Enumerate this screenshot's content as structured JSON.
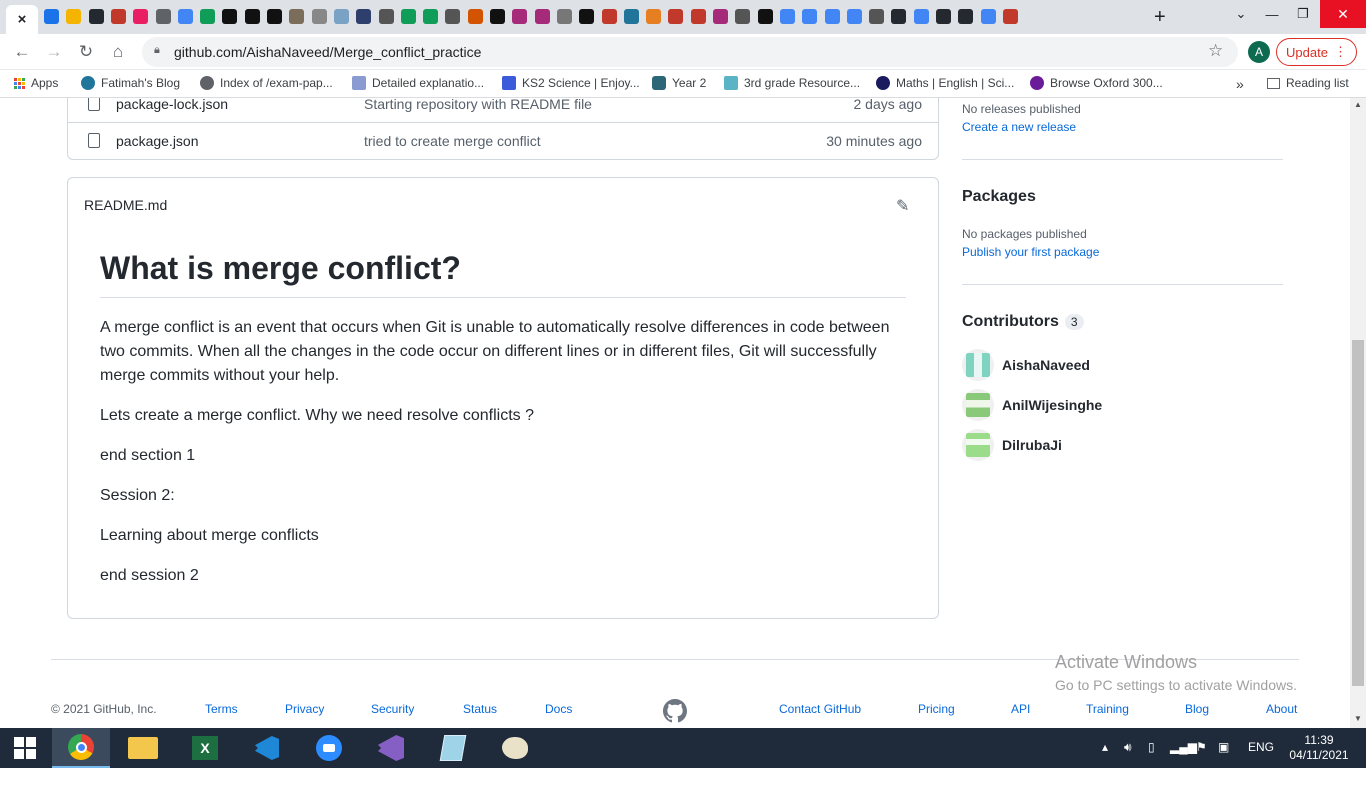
{
  "browser": {
    "url": "github.com/AishaNaveed/Merge_conflict_practice",
    "update_label": "Update",
    "avatar_letter": "A",
    "new_tab_symbol": "+",
    "active_tab_close": "×"
  },
  "bookmarks": [
    {
      "label": "Apps"
    },
    {
      "label": "Fatimah's Blog"
    },
    {
      "label": "Index of /exam-pap..."
    },
    {
      "label": "Detailed explanatio..."
    },
    {
      "label": "KS2 Science | Enjoy..."
    },
    {
      "label": "Year 2"
    },
    {
      "label": "3rd grade Resource..."
    },
    {
      "label": "Maths | English | Sci..."
    },
    {
      "label": "Browse Oxford 300..."
    }
  ],
  "bookmarks_more": "»",
  "reading_list": "Reading list",
  "files": [
    {
      "name": "package-lock.json",
      "message": "Starting repository with README file",
      "age": "2 days ago"
    },
    {
      "name": "package.json",
      "message": "tried to create merge conflict",
      "age": "30 minutes ago"
    }
  ],
  "readme": {
    "filename": "README.md",
    "heading": "What is merge conflict?",
    "paragraphs": [
      "A merge conflict is an event that occurs when Git is unable to automatically resolve differences in code between two commits. When all the changes in the code occur on different lines or in different files, Git will successfully merge commits without your help.",
      "Lets create a merge conflict. Why we need resolve conflicts ?",
      "end section 1",
      "Session 2:",
      "Learning about merge conflicts",
      "end session 2"
    ]
  },
  "sidebar": {
    "releases_text": "No releases published",
    "releases_link": "Create a new release",
    "packages_title": "Packages",
    "packages_text": "No packages published",
    "packages_link": "Publish your first package",
    "contributors_title": "Contributors",
    "contributors_count": "3",
    "contributors": [
      {
        "name": "AishaNaveed",
        "color": "#7fd4c1"
      },
      {
        "name": "AnilWijesinghe",
        "color": "#8bc97a"
      },
      {
        "name": "DilrubaJi",
        "color": "#9bdc8a"
      }
    ]
  },
  "footer": {
    "copyright": "© 2021 GitHub, Inc.",
    "links_left": [
      "Terms",
      "Privacy",
      "Security",
      "Status",
      "Docs"
    ],
    "links_right": [
      "Contact GitHub",
      "Pricing",
      "API",
      "Training",
      "Blog",
      "About"
    ]
  },
  "watermark": {
    "line1": "Activate Windows",
    "line2": "Go to PC settings to activate Windows."
  },
  "taskbar": {
    "lang": "ENG",
    "time": "11:39",
    "date": "04/11/2021"
  },
  "colors": {
    "link": "#0969da",
    "border": "#d0d7de",
    "taskbar": "#1f2b3a",
    "update": "#d93025"
  }
}
